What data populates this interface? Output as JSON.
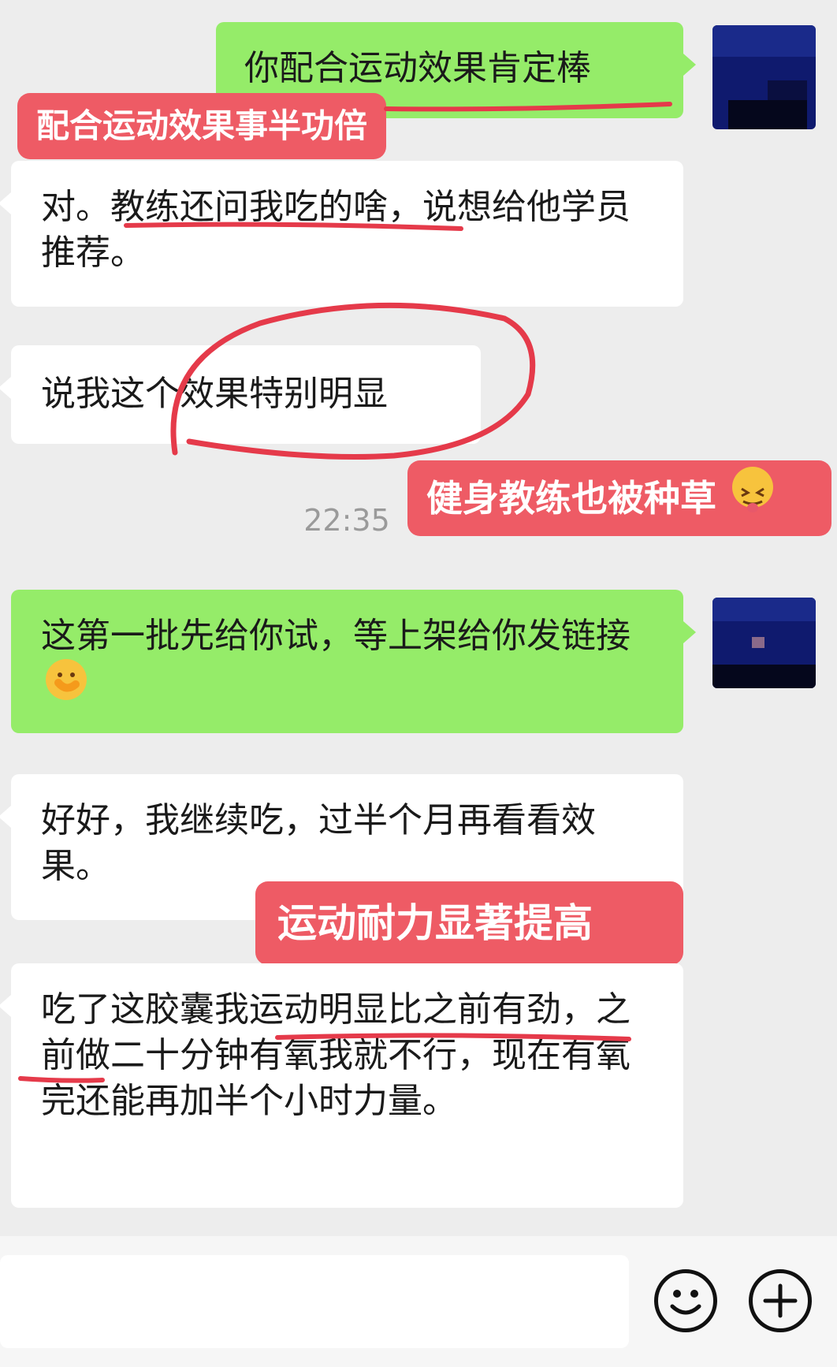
{
  "messages": {
    "m1": {
      "text": "你配合运动效果肯定棒",
      "side": "right",
      "color": "green"
    },
    "m2": {
      "text": "对。教练还问我吃的啥，说想给他学员推荐。",
      "side": "left",
      "color": "white"
    },
    "m3": {
      "text": "说我这个效果特别明显",
      "side": "left",
      "color": "white"
    },
    "timestamp": "22:35",
    "m4": {
      "text": "这第一批先给你试，等上架给你发链接",
      "emoji": "face-with-hand-over-mouth-icon",
      "side": "right",
      "color": "green"
    },
    "m5": {
      "text": "好好，我继续吃，过半个月再看看效果。",
      "side": "left",
      "color": "white"
    },
    "m6": {
      "text": "吃了这胶囊我运动明显比之前有劲，之前做二十分钟有氧我就不行，现在有氧完还能再加半个小时力量。",
      "side": "left",
      "color": "white"
    }
  },
  "annotations": {
    "label1": "配合运动效果事半功倍",
    "label2": "健身教练也被种草",
    "label2_emoji": "squinting-face-with-tongue-icon",
    "label3": "运动耐力显著提高"
  },
  "input_bar": {
    "emoji_button_icon": "smiley-face-icon",
    "add_button_icon": "plus-circle-icon"
  },
  "colors": {
    "background": "#ededed",
    "green_bubble": "#95ec69",
    "white_bubble": "#ffffff",
    "annotation_red": "#ee5b65",
    "underline_red": "#e53a4a"
  }
}
